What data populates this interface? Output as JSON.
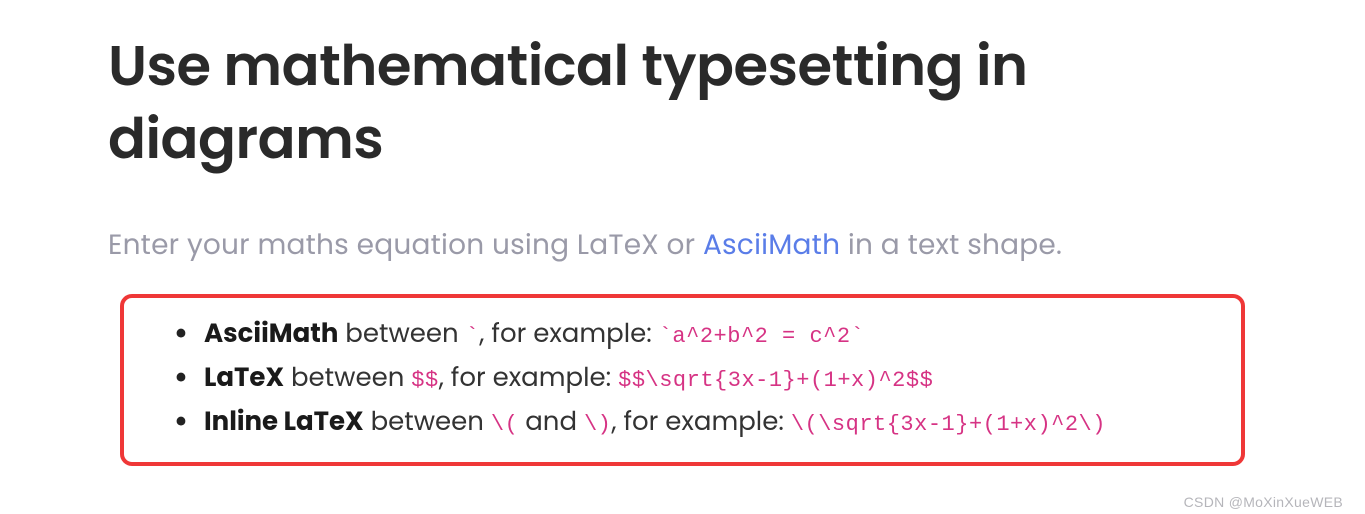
{
  "title": "Use mathematical typesetting in diagrams",
  "intro": {
    "prefix": "Enter your maths equation using LaTeX or ",
    "link": "AsciiMath",
    "suffix": " in a text shape."
  },
  "items": [
    {
      "name": "AsciiMath",
      "between_prefix": " between ",
      "delim": "`",
      "mid": ", for example: ",
      "example": "`a^2+b^2 = c^2`"
    },
    {
      "name": "LaTeX",
      "between_prefix": " between ",
      "delim": "$$",
      "mid": ", for example: ",
      "example": "$$\\sqrt{3x-1}+(1+x)^2$$"
    },
    {
      "name": "Inline LaTeX",
      "between_prefix": " between ",
      "delim": "\\(",
      "mid_and": " and ",
      "delim2": "\\)",
      "mid": ", for example: ",
      "example": "\\(\\sqrt{3x-1}+(1+x)^2\\)"
    }
  ],
  "watermark": "CSDN @MoXinXueWEB"
}
